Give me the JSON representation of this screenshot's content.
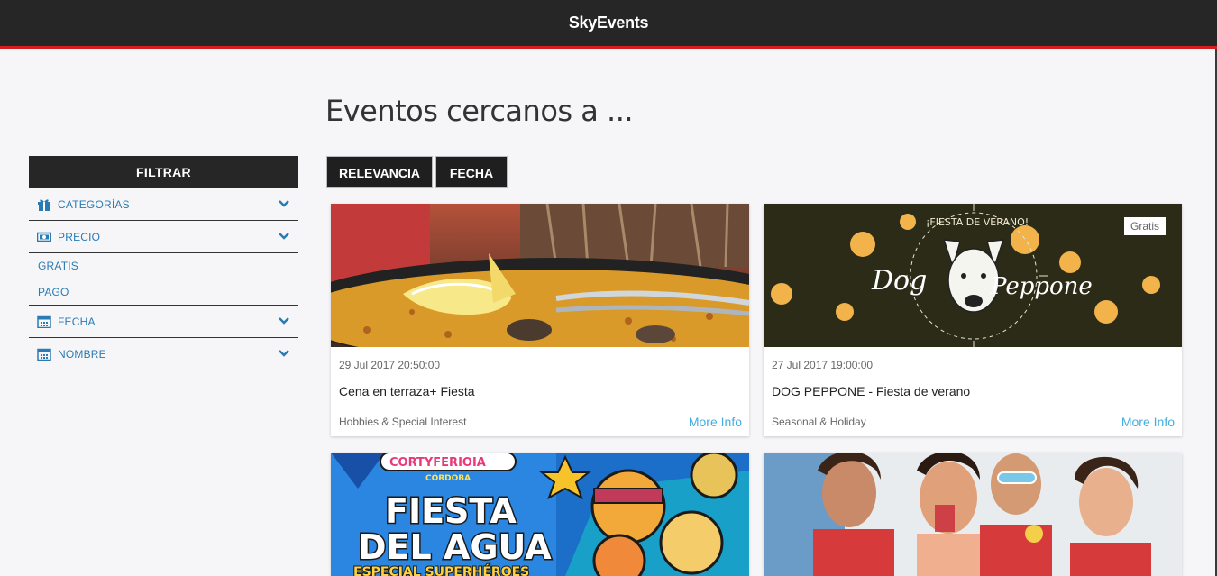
{
  "app": {
    "title": "SkyEvents"
  },
  "page": {
    "title": "Eventos cercanos a ..."
  },
  "sidebar": {
    "header": "FILTRAR",
    "sections": [
      {
        "label": "CATEGORÍAS",
        "icon": "gift-icon"
      },
      {
        "label": "PRECIO",
        "icon": "money-icon"
      },
      {
        "label": "GRATIS"
      },
      {
        "label": "PAGO"
      },
      {
        "label": "FECHA",
        "icon": "calendar-icon"
      },
      {
        "label": "NOMBRE",
        "icon": "calendar-icon"
      }
    ]
  },
  "sort": {
    "relevancia": "RELEVANCIA",
    "fecha": "FECHA"
  },
  "events": [
    {
      "date": "29 Jul 2017 20:50:00",
      "title": "Cena en terraza+ Fiesta",
      "category": "Hobbies & Special Interest",
      "more": "More Info"
    },
    {
      "date": "27 Jul 2017 19:00:00",
      "title": "DOG PEPPONE - Fiesta de verano",
      "category": "Seasonal & Holiday",
      "more": "More Info",
      "badge": "Gratis"
    },
    {
      "image_text": {
        "top": "CORTYFERIOIA",
        "sub": "CÓRDOBA",
        "main1": "FIESTA",
        "main2": "DEL AGUA",
        "bottom": "ESPECIAL SUPERHÉROES"
      }
    },
    {}
  ],
  "images": {
    "dog_text_top": "¡FIESTA DE VERANO!",
    "dog_name_left": "Dog",
    "dog_name_right": "Peppone"
  },
  "colors": {
    "accent": "#d21f1f",
    "link": "#44aee0",
    "filter_text": "#2a7bb3",
    "header_bg": "#262626"
  }
}
